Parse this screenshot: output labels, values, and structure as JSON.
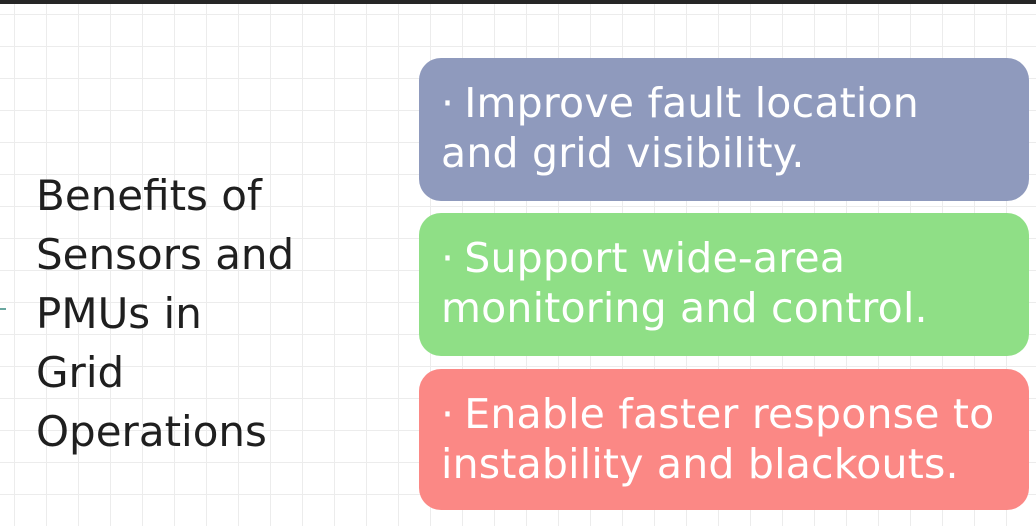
{
  "title": "Benefits of\nSensors and\nPMUs in\nGrid\nOperations",
  "benefits": [
    {
      "bullet": "·",
      "text": "Improve fault location and grid visibility.",
      "color": "#8f9abd"
    },
    {
      "bullet": "·",
      "text": "Support wide-area monitoring and control.",
      "color": "#8fdf86"
    },
    {
      "bullet": "·",
      "text": "Enable faster response to instability and blackouts.",
      "color": "#fb8885"
    }
  ]
}
